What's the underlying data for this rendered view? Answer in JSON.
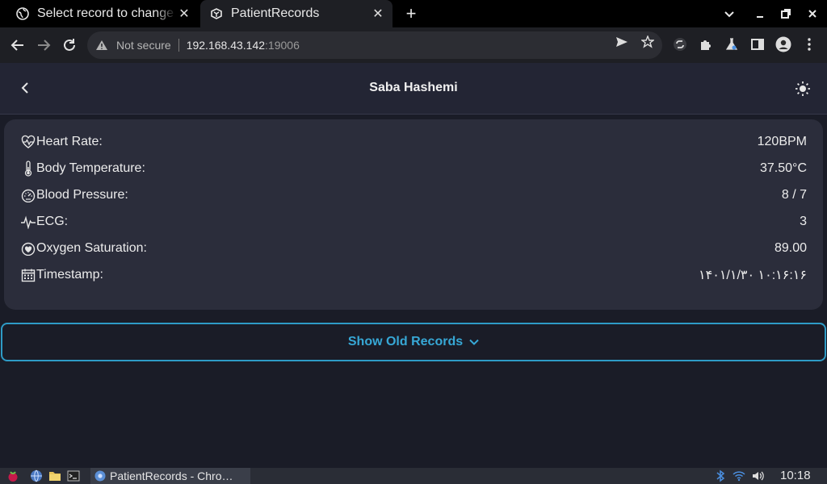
{
  "browser": {
    "tabs": [
      {
        "title": "Select record to change | Django site admin",
        "active": false,
        "icon": "globe-icon"
      },
      {
        "title": "PatientRecords",
        "active": true,
        "icon": "app-logo-icon"
      }
    ],
    "address": {
      "security_label": "Not secure",
      "host": "192.168.43.142",
      "port": ":19006"
    }
  },
  "app": {
    "patient_name": "Saba Hashemi",
    "vitals": [
      {
        "icon": "heart-rate-icon",
        "label": "Heart Rate:",
        "value": "120BPM"
      },
      {
        "icon": "thermometer-icon",
        "label": "Body Temperature:",
        "value": "37.50°C"
      },
      {
        "icon": "gauge-icon",
        "label": "Blood Pressure:",
        "value": "8 / 7"
      },
      {
        "icon": "ecg-icon",
        "label": "ECG:",
        "value": "3"
      },
      {
        "icon": "oxygen-icon",
        "label": "Oxygen Saturation:",
        "value": "89.00"
      },
      {
        "icon": "calendar-icon",
        "label": "Timestamp:",
        "value": "۱۴۰۱/۱/۳۰ ۱۰:۱۶:۱۶"
      }
    ],
    "show_old_label": "Show Old Records"
  },
  "taskbar": {
    "app_label": "PatientRecords - Chro…",
    "clock": "10:18"
  },
  "colors": {
    "accent": "#37a8d6",
    "background": "#1a1c27",
    "card": "#2b2d3b"
  }
}
